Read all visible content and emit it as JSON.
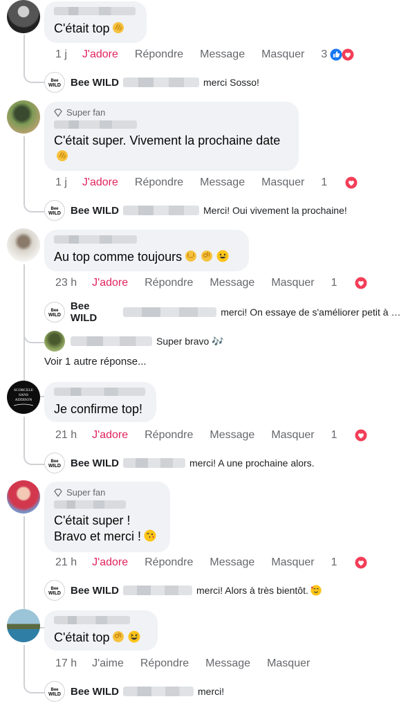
{
  "comments": [
    {
      "text": "C'était top",
      "super_fan": false,
      "time": "1 j",
      "like_label": "J'adore",
      "reply_label": "Répondre",
      "message_label": "Message",
      "hide_label": "Masquer",
      "reaction_count": "3",
      "replies": [
        {
          "name": "Bee WILD",
          "text": "merci Sosso!"
        }
      ]
    },
    {
      "text": "C'était super. Vivement la prochaine date",
      "super_fan": true,
      "time": "1 j",
      "like_label": "J'adore",
      "reply_label": "Répondre",
      "message_label": "Message",
      "hide_label": "Masquer",
      "reaction_count": "1",
      "replies": [
        {
          "name": "Bee WILD",
          "text": "Merci! Oui vivement la prochaine!"
        }
      ]
    },
    {
      "text": "Au top comme toujours",
      "super_fan": false,
      "time": "23 h",
      "like_label": "J'adore",
      "reply_label": "Répondre",
      "message_label": "Message",
      "hide_label": "Masquer",
      "reaction_count": "1",
      "replies": [
        {
          "name": "Bee WILD",
          "text": "merci! On essaye de s'améliorer petit à p..."
        },
        {
          "name": "",
          "text": "Super bravo 🎶"
        }
      ],
      "more_replies": "Voir 1 autre réponse..."
    },
    {
      "text": "Je confirme top!",
      "super_fan": false,
      "time": "21 h",
      "like_label": "J'adore",
      "reply_label": "Répondre",
      "message_label": "Message",
      "hide_label": "Masquer",
      "reaction_count": "1",
      "replies": [
        {
          "name": "Bee WILD",
          "text": "merci! A une prochaine alors."
        }
      ]
    },
    {
      "text": "C'était super !\nBravo et merci !",
      "super_fan": true,
      "time": "21 h",
      "like_label": "J'adore",
      "reply_label": "Répondre",
      "message_label": "Message",
      "hide_label": "Masquer",
      "reaction_count": "1",
      "replies": [
        {
          "name": "Bee WILD",
          "text": "merci! Alors à très bientôt."
        }
      ]
    },
    {
      "text": "C'était top",
      "super_fan": false,
      "time": "17 h",
      "like_label": "J'aime",
      "reply_label": "Répondre",
      "message_label": "Message",
      "hide_label": "Masquer",
      "reaction_count": "",
      "replies": [
        {
          "name": "Bee WILD",
          "text": "merci!"
        }
      ]
    }
  ],
  "badge_label": "Super fan",
  "colors": {
    "bubble": "#f0f2f5",
    "love": "#e0245e",
    "like": "#1877f2",
    "meta": "#65676b"
  }
}
